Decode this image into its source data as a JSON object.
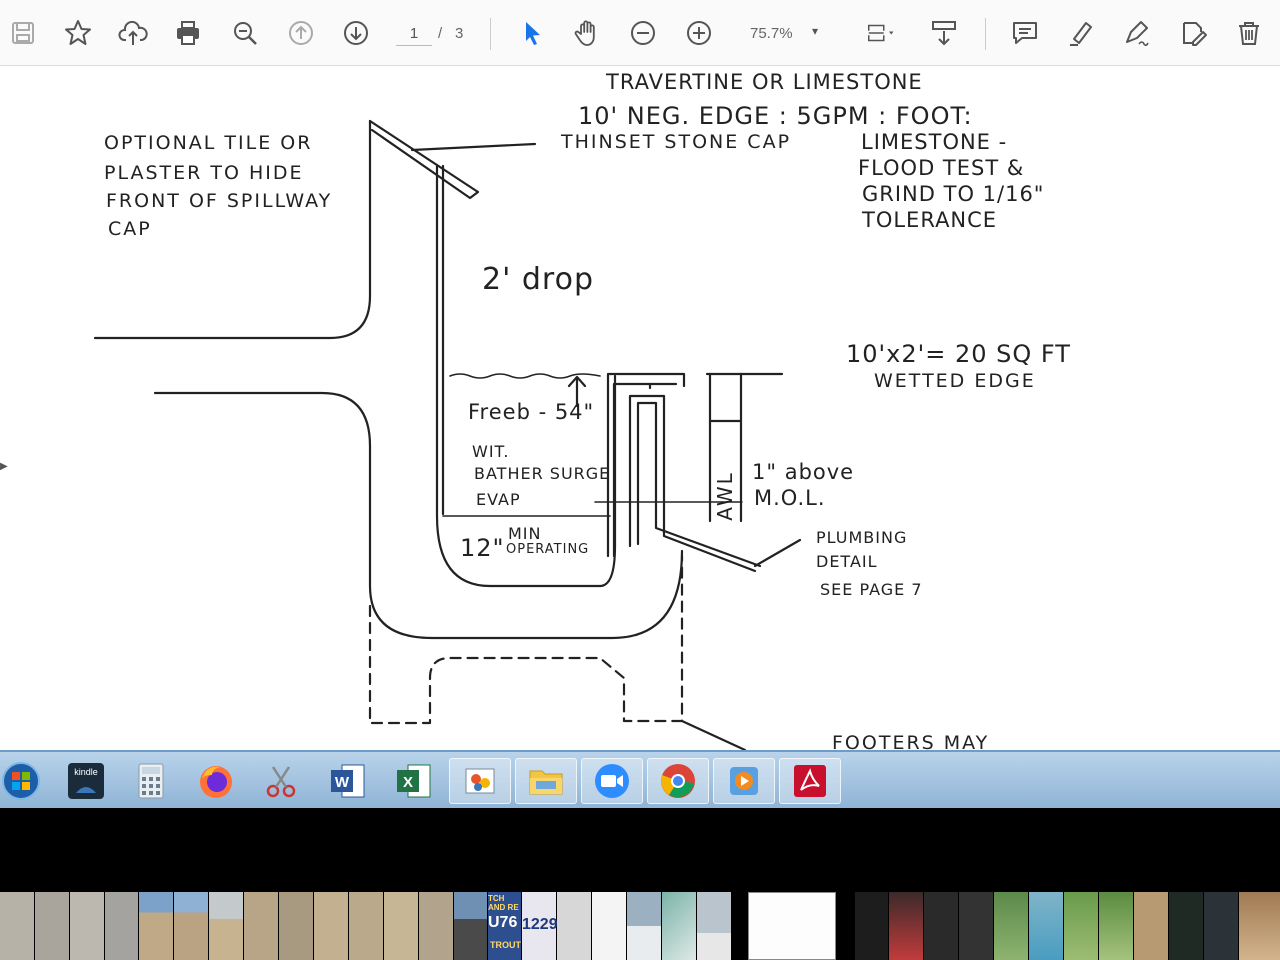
{
  "toolbar": {
    "icons": [
      "save-icon",
      "bookmark-icon",
      "upload-icon",
      "print-icon",
      "find-icon",
      "page-up-icon",
      "page-down-icon",
      "select-arrow-icon",
      "hand-icon",
      "zoom-out-icon",
      "zoom-in-icon",
      "zoom-dropdown-caret",
      "fit-page-icon",
      "scroll-mode-icon",
      "comment-icon",
      "highlight-icon",
      "sign-icon",
      "edit-icon",
      "delete-icon"
    ],
    "page_current": "1",
    "page_separator": "/",
    "page_total": "3",
    "zoom": "75.7%",
    "zoom_caret": "▾"
  },
  "sketch": {
    "title_line1": "TRAVERTINE OR LIMESTONE",
    "title_line2": "10' NEG. EDGE : 5GPM : FOOT:",
    "optional_note": [
      "OPTIONAL TILE OR",
      "PLASTER TO HIDE",
      "FRONT OF SPILLWAY",
      "CAP"
    ],
    "cap_label": "THINSET STONE CAP",
    "limestone_note": [
      "LIMESTONE -",
      "FLOOD TEST &",
      "GRIND TO 1/16\"",
      "TOLERANCE"
    ],
    "drop_label": "2' drop",
    "area_label": "10'x2'= 20 SQ FT",
    "wetted_label": "WETTED EDGE",
    "freeboard_label": "Freeb - 54\"",
    "surge_note": [
      "WIT.",
      "BATHER SURGE",
      "EVAP"
    ],
    "min_depth": "12\"",
    "min_operating": [
      "MIN",
      "OPERATING"
    ],
    "awl_label": "AWL",
    "above_mol": [
      "1\" above",
      "M.O.L."
    ],
    "plumbing_note": [
      "PLUMBING",
      "DETAIL",
      "SEE PAGE 7"
    ],
    "footers_note": "FOOTERS MAY"
  },
  "taskbar": {
    "items": [
      "start-orb-icon",
      "kindle-icon",
      "calculator-icon",
      "firefox-icon",
      "snipping-tool-icon",
      "word-icon",
      "excel-icon",
      "paint-icon",
      "file-explorer-icon",
      "zoom-app-icon",
      "chrome-icon",
      "media-player-icon",
      "acrobat-icon"
    ],
    "kindle_label": "kindle",
    "word_letter": "W",
    "excel_letter": "X"
  },
  "thumbnails": {
    "texts": [
      "TCH AND RE",
      "U76",
      "1229",
      "TROUT"
    ]
  },
  "colors": {
    "toolbar_bg": "#fafafa",
    "accent_blue": "#1a73e8",
    "taskbar_blue": "#9fc1e1",
    "acrobat_red": "#c8102e"
  }
}
